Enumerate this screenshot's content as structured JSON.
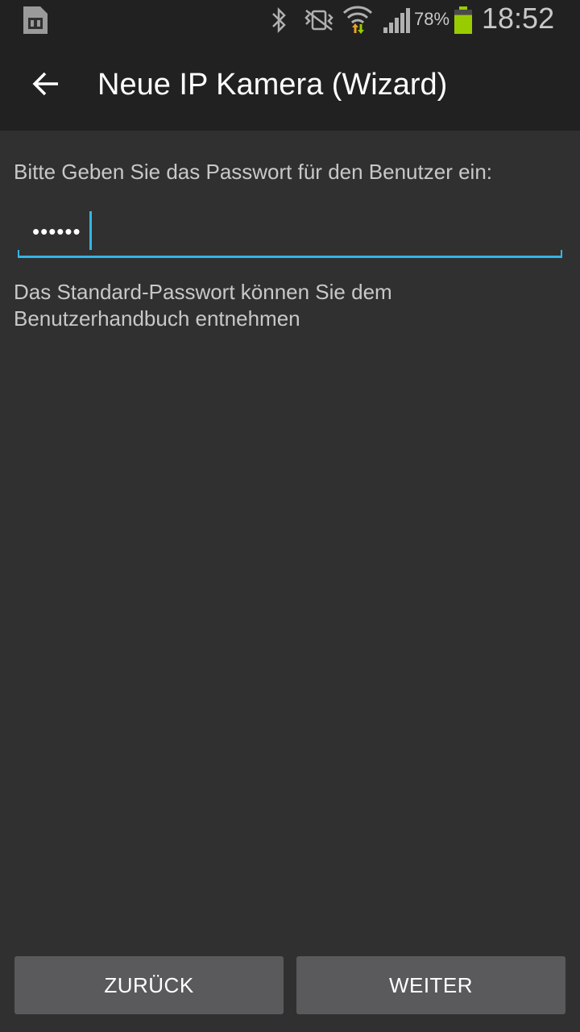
{
  "status_bar": {
    "battery_percent": "78%",
    "battery_level": 0.78,
    "time": "18:52",
    "icons": [
      "sim-card-icon",
      "bluetooth-icon",
      "vibrate-icon",
      "wifi-icon",
      "signal-icon",
      "battery-icon"
    ]
  },
  "action_bar": {
    "back_icon": "arrow-left-icon",
    "title": "Neue IP Kamera (Wizard)"
  },
  "form": {
    "prompt": "Bitte Geben Sie das Passwort für den Benutzer ein:",
    "password_value": "••••••",
    "hint": "Das Standard-Passwort können Sie dem Benutzerhandbuch entnehmen"
  },
  "buttons": {
    "back_label": "ZURÜCK",
    "next_label": "WEITER"
  },
  "colors": {
    "accent": "#33b5e5",
    "background": "#303030",
    "bar": "#212121",
    "button": "#5a5a5c",
    "battery": "#99cc00"
  }
}
